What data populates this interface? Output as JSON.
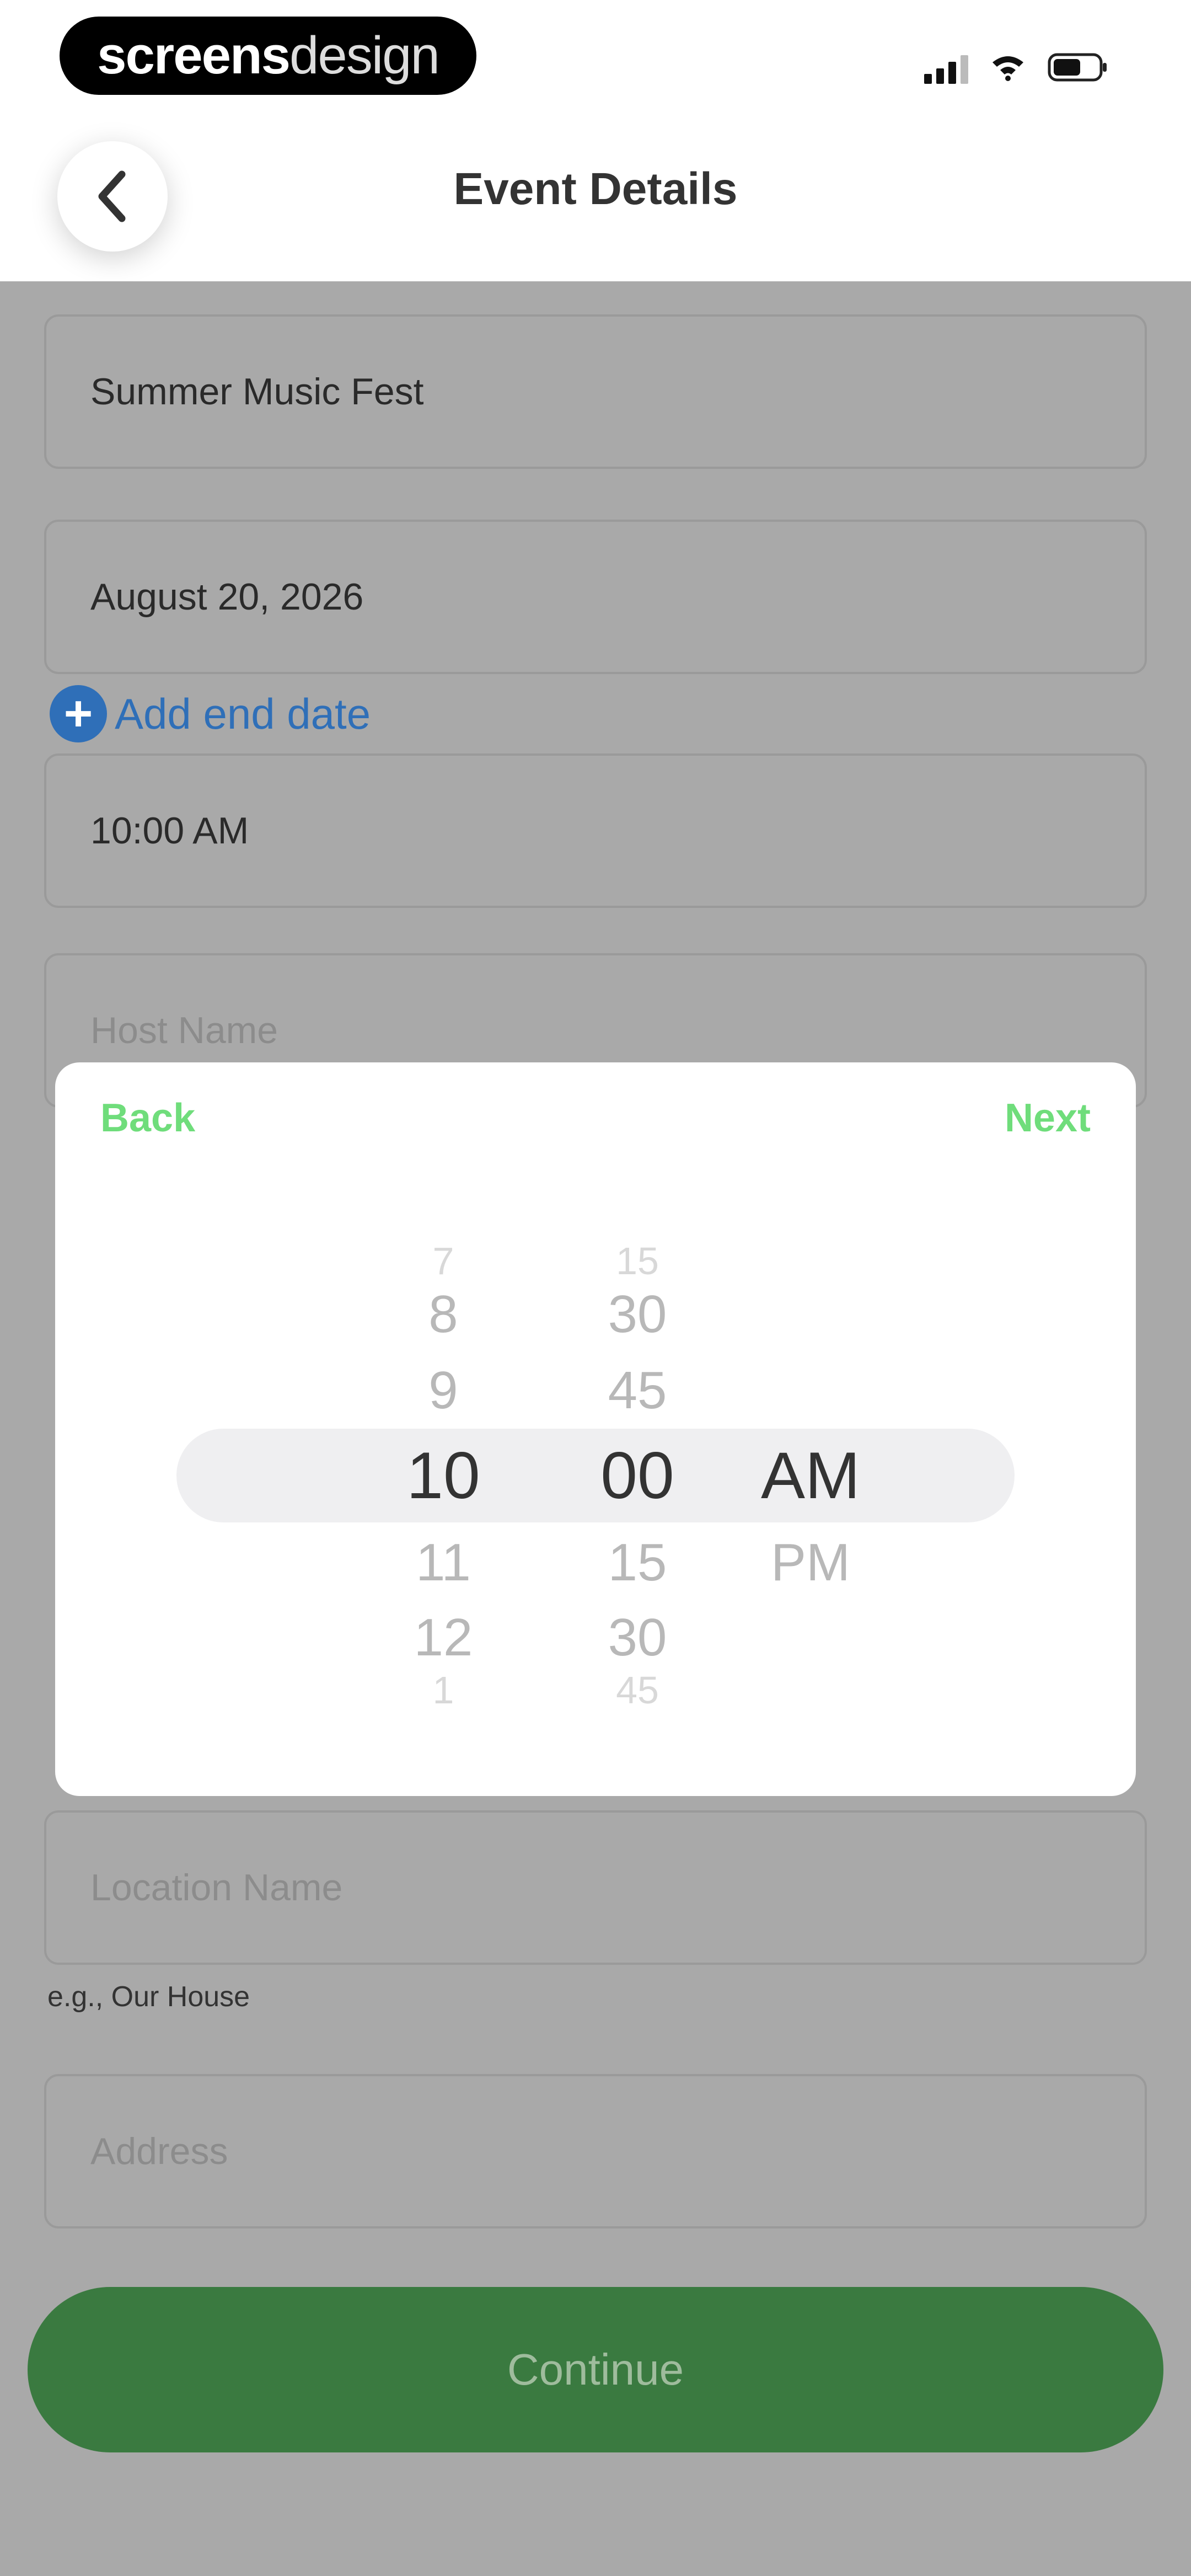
{
  "status_bar": {
    "logo_bold": "screens",
    "logo_light": "design"
  },
  "header": {
    "title": "Event Details"
  },
  "form": {
    "event_name": "Summer Music Fest",
    "date": "August 20, 2026",
    "add_end_date": "Add end date",
    "time": "10:00 AM",
    "host_placeholder": "Host Name",
    "location_placeholder": "Location Name",
    "location_hint": "e.g., Our House",
    "address_placeholder": "Address",
    "continue_label": "Continue"
  },
  "time_picker": {
    "back_label": "Back",
    "next_label": "Next",
    "hours": [
      "7",
      "8",
      "9",
      "10",
      "11",
      "12",
      "1"
    ],
    "minutes": [
      "15",
      "30",
      "45",
      "00",
      "15",
      "30",
      "45"
    ],
    "periods": [
      "AM",
      "PM"
    ],
    "selected": {
      "hour": "10",
      "minute": "00",
      "period": "AM"
    }
  },
  "icons": {
    "back": "chevron-left-icon",
    "add": "plus-circle-icon",
    "signal": "cellular-signal-icon",
    "wifi": "wifi-icon",
    "battery": "battery-icon"
  }
}
